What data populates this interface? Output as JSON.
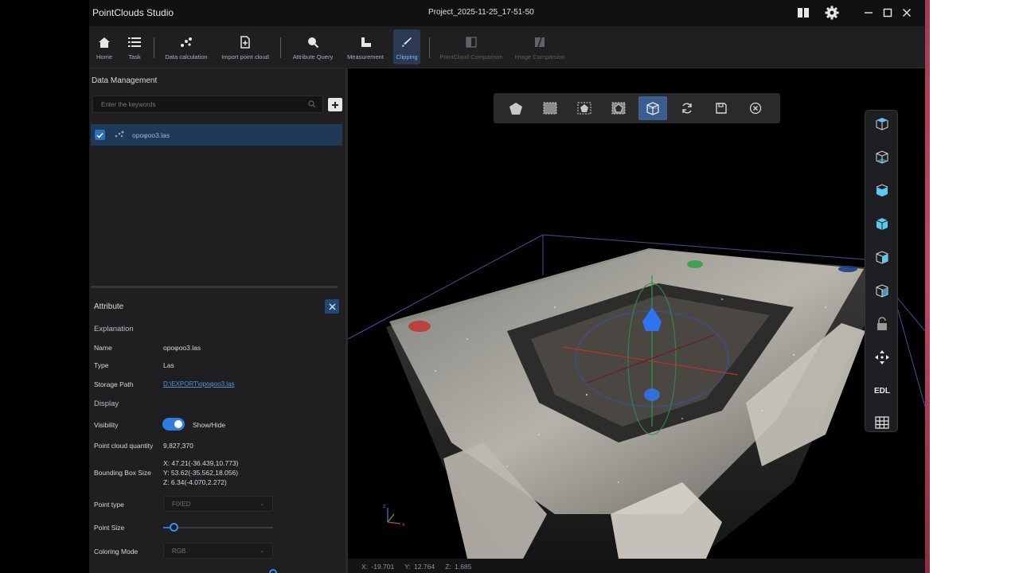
{
  "app": {
    "title": "PointClouds Studio",
    "project": "Project_2025-11-25_17-51-50"
  },
  "toolbar": {
    "home": "Home",
    "task": "Task",
    "data_calc": "Data calculation",
    "import": "Import point cloud",
    "attr_query": "Attribute Query",
    "measurement": "Measurement",
    "clipping": "Clipping",
    "pc_compare": "PointCloud Comparison",
    "img_compare": "Image Comparsion"
  },
  "data_management": {
    "title": "Data Management",
    "search_placeholder": "Enter the keywords",
    "files": [
      {
        "name": "ороφоо3.las",
        "checked": true
      }
    ]
  },
  "attribute": {
    "title": "Attribute",
    "explanation": "Explanation",
    "name_label": "Name",
    "name_value": "ороφоо3.las",
    "type_label": "Type",
    "type_value": "Las",
    "path_label": "Storage Path",
    "path_value": "D:\\EXPORT\\ороφоо3.las",
    "display": "Display",
    "visibility_label": "Visibility",
    "visibility_value": "Show/Hide",
    "visibility_on": true,
    "quantity_label": "Point cloud quantity",
    "quantity_value": "9,827,370",
    "bbox_label": "Bounding Box Size",
    "bbox_x": "X: 47.21(-36.439,10.773)",
    "bbox_y": "Y: 53.62(-35.562,18.056)",
    "bbox_z": "Z: 6.34(-4.070,2.272)",
    "point_type_label": "Point type",
    "point_type_value": "FIXED",
    "point_size_label": "Point Size",
    "point_size_fraction": 0.1,
    "coloring_label": "Coloring Mode",
    "coloring_value": "RGB"
  },
  "status": {
    "x": "X: -19.701",
    "y": "Y: 12.764",
    "z": "Z: 1.685"
  },
  "view_panel": {
    "edl": "EDL"
  },
  "colors": {
    "accent": "#2f7be0",
    "selection": "#1f3a57",
    "panel": "#1f1f22",
    "viewport": "#000000",
    "view_cube": "#5bc8f0"
  }
}
